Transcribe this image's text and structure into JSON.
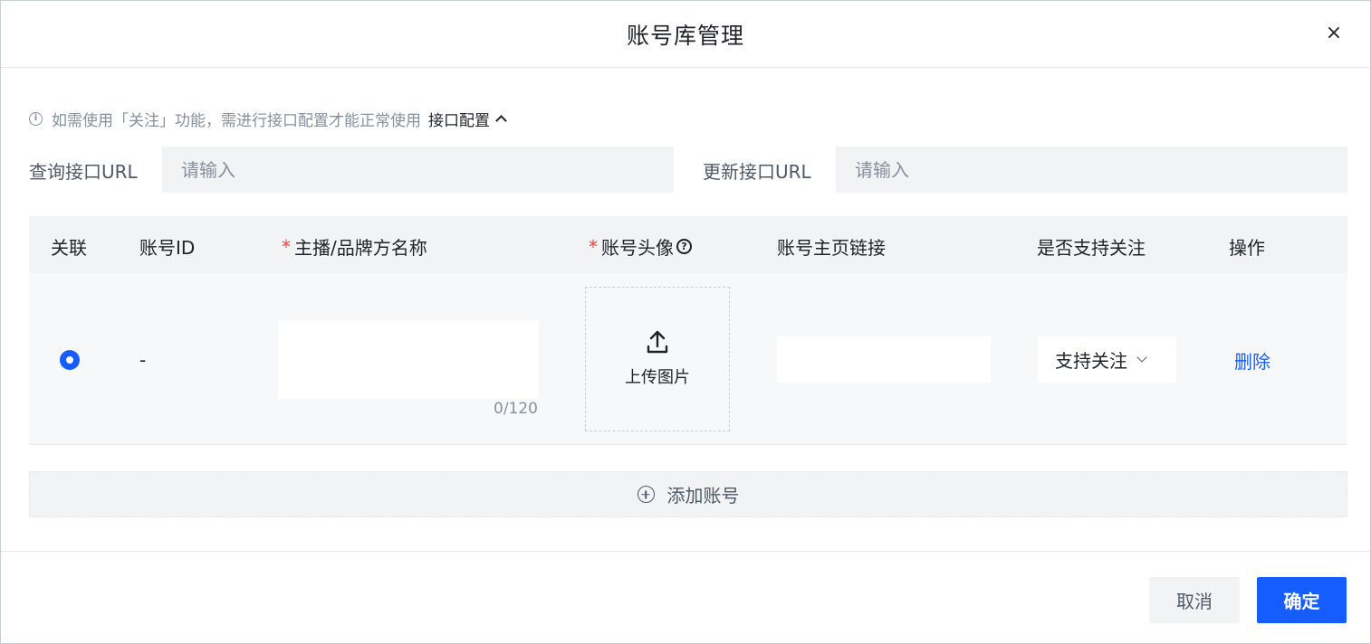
{
  "dialog": {
    "title": "账号库管理",
    "close_symbol": "×"
  },
  "tip": {
    "icon": "info-icon",
    "text": "如需使用「关注」功能，需进行接口配置才能正常使用",
    "link": "接口配置"
  },
  "api": {
    "query_label": "查询接口URL",
    "query_placeholder": "请输入",
    "update_label": "更新接口URL",
    "update_placeholder": "请输入"
  },
  "table": {
    "headers": {
      "link": "关联",
      "account_id": "账号ID",
      "name": "主播/品牌方名称",
      "avatar": "账号头像",
      "homepage": "账号主页链接",
      "follow": "是否支持关注",
      "action": "操作"
    },
    "required_mark": "*",
    "row": {
      "linked": true,
      "account_id": "-",
      "name_counter": "0/120",
      "upload_label": "上传图片",
      "follow_value": "支持关注",
      "delete_label": "删除"
    }
  },
  "add_label": "添加账号",
  "footer": {
    "cancel": "取消",
    "confirm": "确定"
  },
  "colors": {
    "primary": "#165dff",
    "required": "#f53f3f",
    "header_bg": "#f2f3f5",
    "row_bg": "#f7f8fa"
  }
}
